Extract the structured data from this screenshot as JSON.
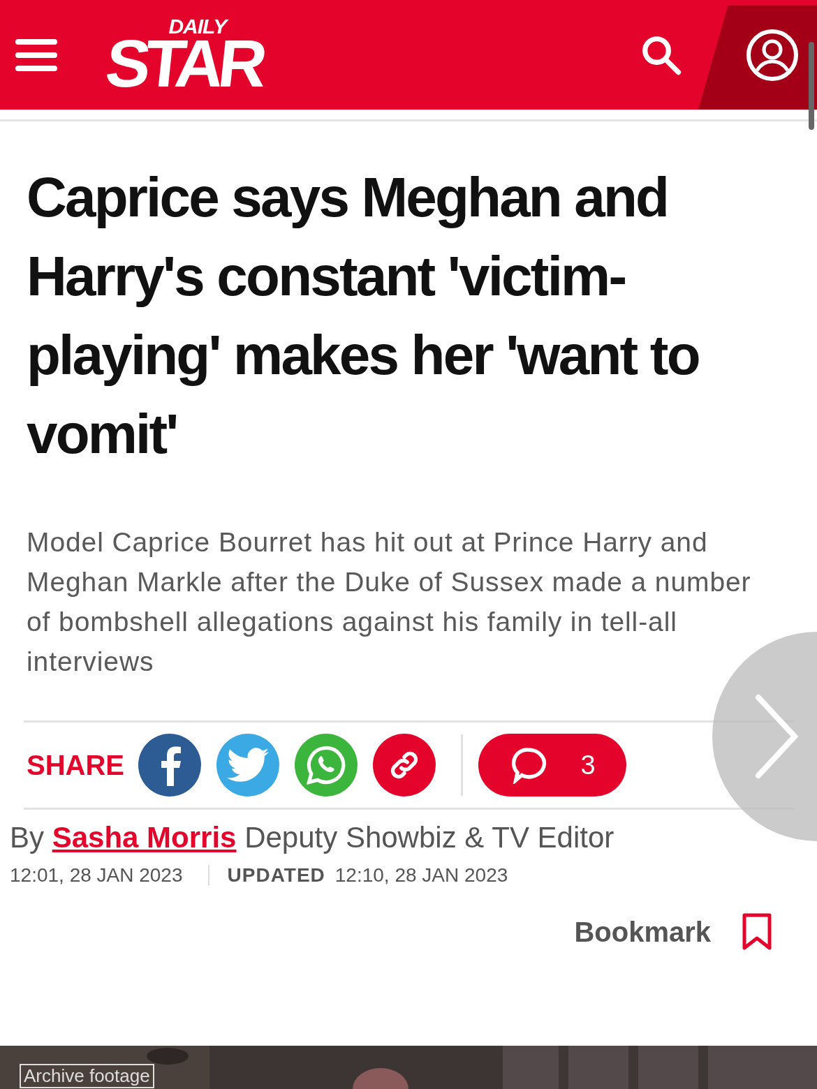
{
  "header": {
    "logo_top": "DAILY",
    "logo_main": "STAR"
  },
  "article": {
    "headline": "Caprice says Meghan and Harry's constant 'victim-playing' makes her 'want to vomit'",
    "standfirst": "Model Caprice Bourret has hit out at Prince Harry and Meghan Markle after the Duke of Sussex made a number of bombshell allegations against his family in tell-all interviews",
    "share_label": "SHARE",
    "share_buttons": [
      {
        "kind": "facebook",
        "color": "#2d5b94"
      },
      {
        "kind": "twitter",
        "color": "#3aa9e4"
      },
      {
        "kind": "whatsapp",
        "color": "#3bb53b"
      },
      {
        "kind": "link",
        "color": "#e4042b"
      }
    ],
    "comments_count": "3",
    "byline": {
      "prefix": "By",
      "author": "Sasha Morris",
      "role": "Deputy Showbiz & TV Editor"
    },
    "published": "12:01, 28 JAN 2023",
    "updated_label": "UPDATED",
    "updated": "12:10, 28 JAN 2023",
    "bookmark": "Bookmark"
  },
  "video": {
    "kind": "picture",
    "badge": "Archive footage"
  }
}
